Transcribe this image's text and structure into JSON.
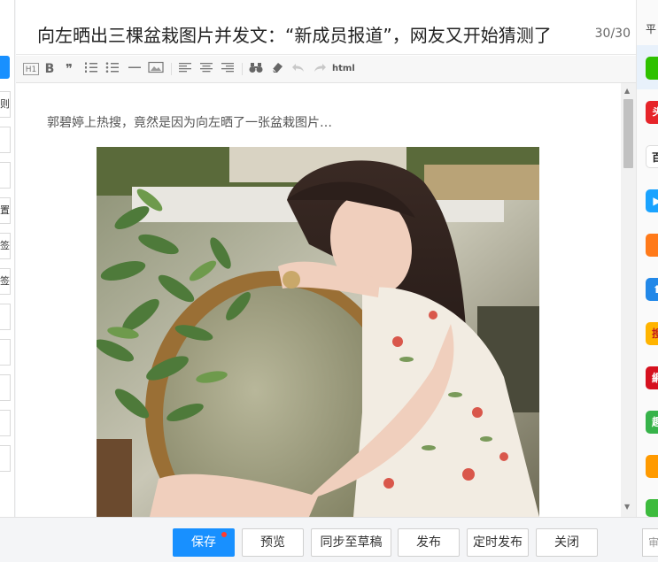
{
  "editor": {
    "title": "向左晒出三棵盆栽图片并发文：“新成员报道”，网友又开始猜测了",
    "title_count": "30/30",
    "lead_paragraph": "郭碧婷上热搜，竟然是因为向左晒了一张盆栽图片…",
    "toolbar": {
      "h1_label": "H1",
      "bold_label": "B",
      "quote_label": "❞",
      "html_label": "html",
      "icons": [
        "heading-icon",
        "bold-icon",
        "quote-icon",
        "ordered-list-icon",
        "unordered-list-icon",
        "horizontal-rule-icon",
        "image-icon",
        "align-left-icon",
        "align-center-icon",
        "align-right-icon",
        "binoculars-icon",
        "eraser-icon",
        "undo-icon",
        "redo-icon",
        "html-icon"
      ]
    },
    "photo": {
      "alt": "woman leaning on green velvet chair beside potted plants"
    }
  },
  "left_sidebar": {
    "visible_fragments": [
      "则",
      "",
      "",
      "置",
      "签",
      "签",
      "",
      "",
      "",
      "",
      ""
    ]
  },
  "platform_panel": {
    "title": "平",
    "platforms": [
      {
        "label": "",
        "color": "#2dc100",
        "icon": "wechat-icon"
      },
      {
        "label": "头",
        "color": "#e62429",
        "icon": "toutiao-icon"
      },
      {
        "label": "百",
        "color": "#ffffff",
        "icon": "baijiahao-icon"
      },
      {
        "label": "▶",
        "color": "#1aa3ff",
        "icon": "video-platform-icon"
      },
      {
        "label": "",
        "color": "#ff7a1a",
        "icon": "mascot-icon"
      },
      {
        "label": "⬆",
        "color": "#2288e8",
        "icon": "upload-platform-icon"
      },
      {
        "label": "搜",
        "color": "#ffb400",
        "icon": "sohu-icon"
      },
      {
        "label": "網",
        "color": "#d6111f",
        "icon": "netease-icon"
      },
      {
        "label": "趣",
        "color": "#37b34a",
        "icon": "qutoutiao-icon"
      },
      {
        "label": "",
        "color": "#ff9a00",
        "icon": "weibo-icon"
      },
      {
        "label": "",
        "color": "#3dbb3d",
        "icon": "extra-platform-icon"
      }
    ]
  },
  "actions": {
    "save": "保存",
    "preview": "预览",
    "sync_draft": "同步至草稿",
    "publish": "发布",
    "scheduled_publish": "定时发布",
    "close": "关闭",
    "right_edge": "审"
  }
}
